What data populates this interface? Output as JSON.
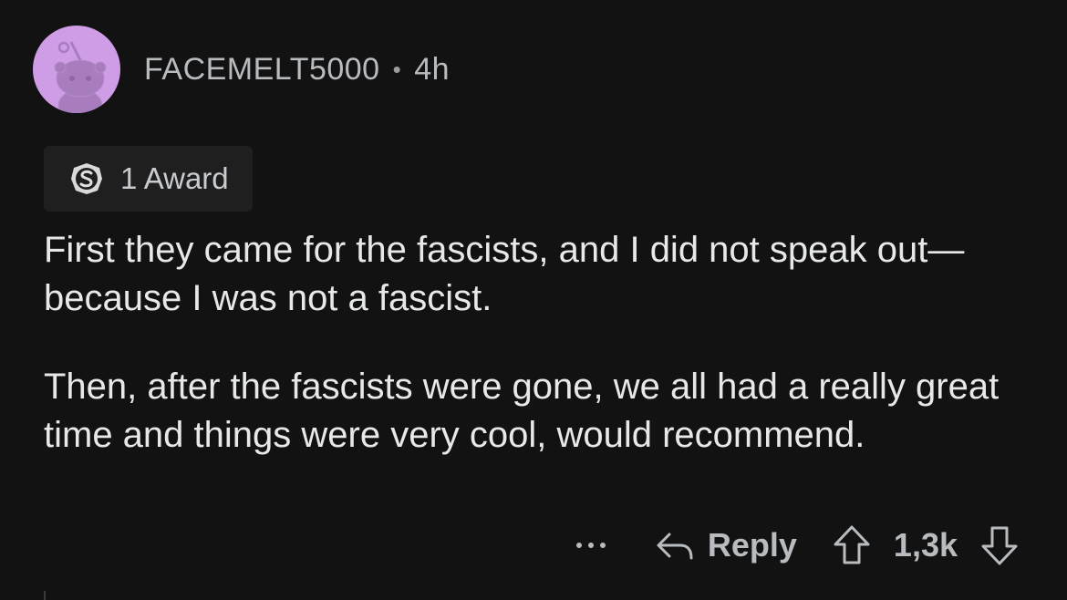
{
  "comment": {
    "author": "FACEMELT5000",
    "separator": "•",
    "age": "4h",
    "avatar_color": "#cf9de6",
    "award": {
      "icon": "silver-award-icon",
      "label": "1 Award"
    },
    "paragraphs": [
      "First they came for the fascists, and I did not speak out—because I was not a fascist.",
      "Then, after the fascists were gone, we all had a really great time and things were very cool, would recommend."
    ],
    "actions": {
      "more_icon": "more-options-icon",
      "reply_label": "Reply",
      "vote_count": "1,3k"
    }
  }
}
